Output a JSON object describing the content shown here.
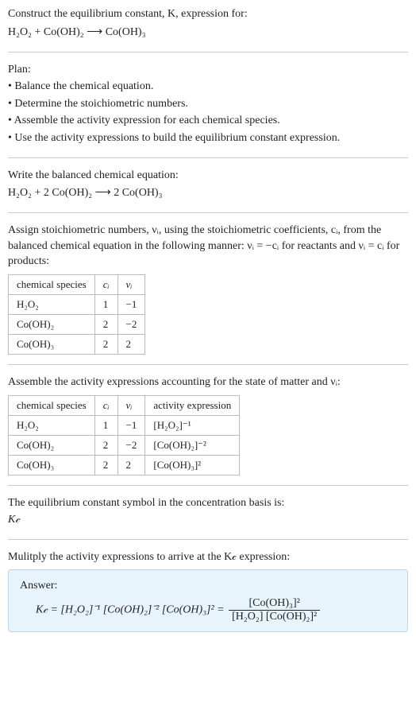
{
  "s1": {
    "title": "Construct the equilibrium constant, K, expression for:",
    "eq": "H₂O₂ + Co(OH)₂  ⟶  Co(OH)₃"
  },
  "s2": {
    "title": "Plan:",
    "b1": "• Balance the chemical equation.",
    "b2": "• Determine the stoichiometric numbers.",
    "b3": "• Assemble the activity expression for each chemical species.",
    "b4": "• Use the activity expressions to build the equilibrium constant expression."
  },
  "s3": {
    "title": "Write the balanced chemical equation:",
    "eq": "H₂O₂ + 2 Co(OH)₂  ⟶  2 Co(OH)₃"
  },
  "s4": {
    "text": "Assign stoichiometric numbers, νᵢ, using the stoichiometric coefficients, cᵢ, from the balanced chemical equation in the following manner: νᵢ = −cᵢ for reactants and νᵢ = cᵢ for products:",
    "h1": "chemical species",
    "h2": "cᵢ",
    "h3": "νᵢ",
    "r1c1": "H₂O₂",
    "r1c2": "1",
    "r1c3": "−1",
    "r2c1": "Co(OH)₂",
    "r2c2": "2",
    "r2c3": "−2",
    "r3c1": "Co(OH)₃",
    "r3c2": "2",
    "r3c3": "2"
  },
  "s5": {
    "text": "Assemble the activity expressions accounting for the state of matter and νᵢ:",
    "h1": "chemical species",
    "h2": "cᵢ",
    "h3": "νᵢ",
    "h4": "activity expression",
    "r1c1": "H₂O₂",
    "r1c2": "1",
    "r1c3": "−1",
    "r1c4": "[H₂O₂]⁻¹",
    "r2c1": "Co(OH)₂",
    "r2c2": "2",
    "r2c3": "−2",
    "r2c4": "[Co(OH)₂]⁻²",
    "r3c1": "Co(OH)₃",
    "r3c2": "2",
    "r3c3": "2",
    "r3c4": "[Co(OH)₃]²"
  },
  "s6": {
    "text": "The equilibrium constant symbol in the concentration basis is:",
    "sym": "K𝒸"
  },
  "s7": {
    "text": "Mulitply the activity expressions to arrive at the K𝒸 expression:",
    "answerLabel": "Answer:",
    "lhs": "K𝒸 = [H₂O₂]⁻¹ [Co(OH)₂]⁻² [Co(OH)₃]² = ",
    "num": "[Co(OH)₃]²",
    "den": "[H₂O₂] [Co(OH)₂]²"
  }
}
